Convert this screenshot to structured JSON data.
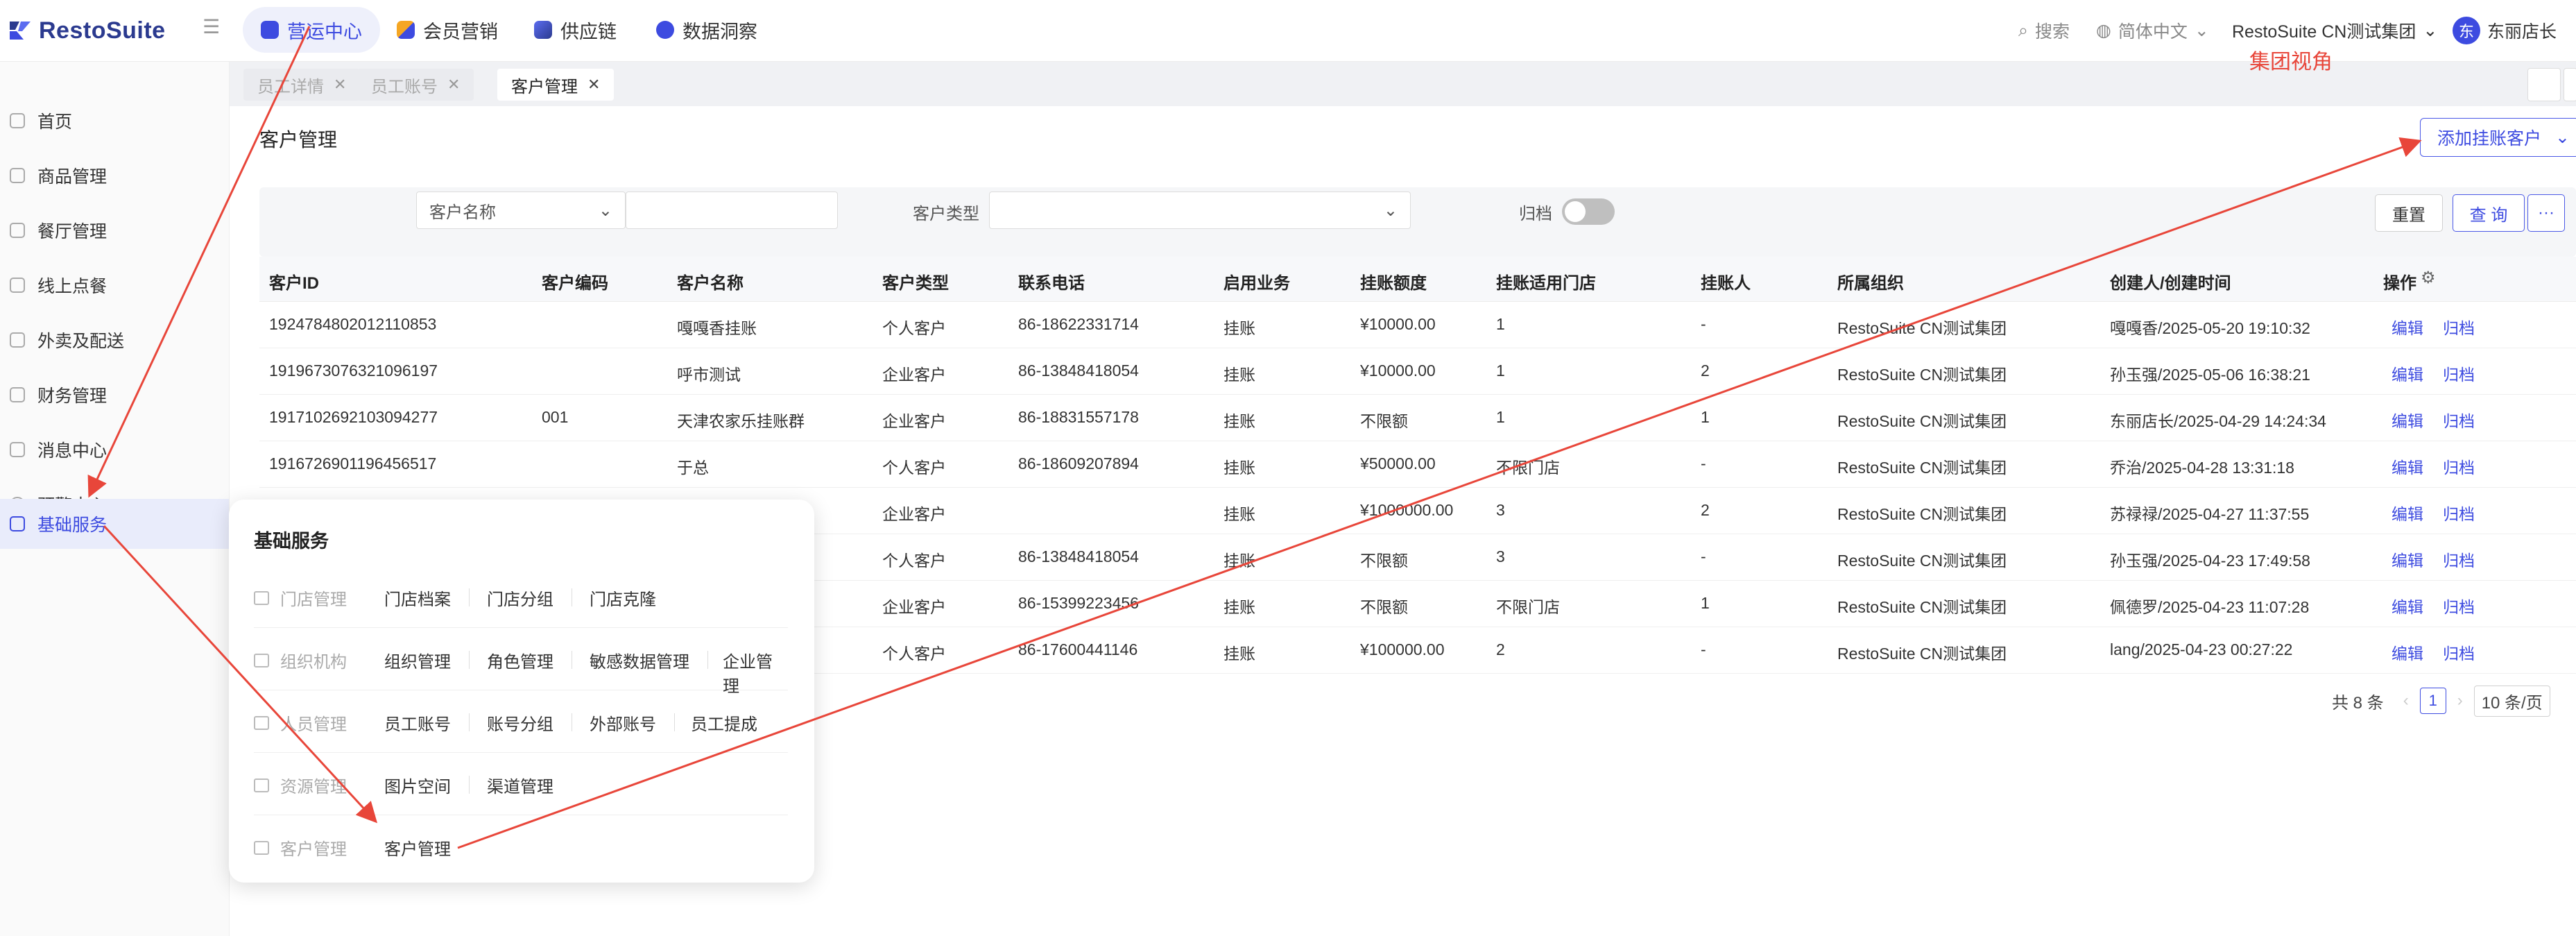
{
  "app": {
    "name": "RestoSuite"
  },
  "topnav": {
    "items": [
      {
        "label": "营运中心",
        "color": "#3d4be0"
      },
      {
        "label": "会员营销",
        "color": "#f5a623"
      },
      {
        "label": "供应链",
        "color": "#3d4be0"
      },
      {
        "label": "数据洞察",
        "color": "#3d4be0"
      }
    ],
    "search_label": "搜索",
    "language": "简体中文",
    "org": "RestoSuite CN测试集团",
    "user": "东丽店长",
    "avatar_char": "东"
  },
  "sidebar": {
    "items": [
      {
        "label": "首页"
      },
      {
        "label": "商品管理"
      },
      {
        "label": "餐厅管理"
      },
      {
        "label": "线上点餐"
      },
      {
        "label": "外卖及配送"
      },
      {
        "label": "财务管理"
      },
      {
        "label": "消息中心"
      },
      {
        "label": "预警中心"
      },
      {
        "label": "基础服务"
      }
    ]
  },
  "tabs": [
    {
      "label": "员工详情"
    },
    {
      "label": "员工账号"
    },
    {
      "label": "客户管理"
    }
  ],
  "annotation_text": "集团视角",
  "page": {
    "title": "客户管理",
    "add_button": "添加挂账客户"
  },
  "filters": {
    "name_select": "客户名称",
    "type_label": "客户类型",
    "archive_label": "归档",
    "reset": "重置",
    "query": "查 询",
    "more": "···"
  },
  "table": {
    "columns": [
      "客户ID",
      "客户编码",
      "客户名称",
      "客户类型",
      "联系电话",
      "启用业务",
      "挂账额度",
      "挂账适用门店",
      "挂账人",
      "所属组织",
      "创建人/创建时间",
      "操作"
    ],
    "rows": [
      {
        "id": "1924784802012110853",
        "code": "",
        "name": "嘎嘎香挂账",
        "type": "个人客户",
        "phone": "86-18622331714",
        "biz": "挂账",
        "limit": "¥10000.00",
        "stores": "1",
        "payer": "-",
        "org": "RestoSuite CN测试集团",
        "creator": "嘎嘎香/2025-05-20 19:10:32"
      },
      {
        "id": "1919673076321096197",
        "code": "",
        "name": "呼市测试",
        "type": "企业客户",
        "phone": "86-13848418054",
        "biz": "挂账",
        "limit": "¥10000.00",
        "stores": "1",
        "payer": "2",
        "org": "RestoSuite CN测试集团",
        "creator": "孙玉强/2025-05-06 16:38:21"
      },
      {
        "id": "1917102692103094277",
        "code": "001",
        "name": "天津农家乐挂账群",
        "type": "企业客户",
        "phone": "86-18831557178",
        "biz": "挂账",
        "limit": "不限额",
        "stores": "1",
        "payer": "1",
        "org": "RestoSuite CN测试集团",
        "creator": "东丽店长/2025-04-29 14:24:34"
      },
      {
        "id": "1916726901196456517",
        "code": "",
        "name": "于总",
        "type": "个人客户",
        "phone": "86-18609207894",
        "biz": "挂账",
        "limit": "¥50000.00",
        "stores": "不限门店",
        "payer": "-",
        "org": "RestoSuite CN测试集团",
        "creator": "乔治/2025-04-28 13:31:18"
      },
      {
        "id": "",
        "code": "",
        "name": "",
        "type": "企业客户",
        "phone": "",
        "biz": "挂账",
        "limit": "¥1000000.00",
        "stores": "3",
        "payer": "2",
        "org": "RestoSuite CN测试集团",
        "creator": "苏禄禄/2025-04-27 11:37:55"
      },
      {
        "id": "",
        "code": "",
        "name": "",
        "type": "个人客户",
        "phone": "86-13848418054",
        "biz": "挂账",
        "limit": "不限额",
        "stores": "3",
        "payer": "-",
        "org": "RestoSuite CN测试集团",
        "creator": "孙玉强/2025-04-23 17:49:58"
      },
      {
        "id": "",
        "code": "",
        "name": "",
        "type": "企业客户",
        "phone": "86-15399223456",
        "biz": "挂账",
        "limit": "不限额",
        "stores": "不限门店",
        "payer": "1",
        "org": "RestoSuite CN测试集团",
        "creator": "佩德罗/2025-04-23 11:07:28"
      },
      {
        "id": "",
        "code": "",
        "name": "",
        "type": "个人客户",
        "phone": "86-17600441146",
        "biz": "挂账",
        "limit": "¥100000.00",
        "stores": "2",
        "payer": "-",
        "org": "RestoSuite CN测试集团",
        "creator": "lang/2025-04-23 00:27:22"
      }
    ],
    "action_edit": "编辑",
    "action_archive": "归档"
  },
  "pagination": {
    "total": "共 8 条",
    "current": "1",
    "page_size": "10 条/页"
  },
  "popup": {
    "title": "基础服务",
    "groups": [
      {
        "category": "门店管理",
        "links": [
          "门店档案",
          "门店分组",
          "门店克隆"
        ]
      },
      {
        "category": "组织机构",
        "links": [
          "组织管理",
          "角色管理",
          "敏感数据管理",
          "企业管理"
        ]
      },
      {
        "category": "人员管理",
        "links": [
          "员工账号",
          "账号分组",
          "外部账号",
          "员工提成"
        ]
      },
      {
        "category": "资源管理",
        "links": [
          "图片空间",
          "渠道管理"
        ]
      },
      {
        "category": "客户管理",
        "links": [
          "客户管理"
        ]
      }
    ]
  },
  "colors": {
    "accent": "#3d4be0",
    "annotation_arrow": "#e8463a"
  }
}
